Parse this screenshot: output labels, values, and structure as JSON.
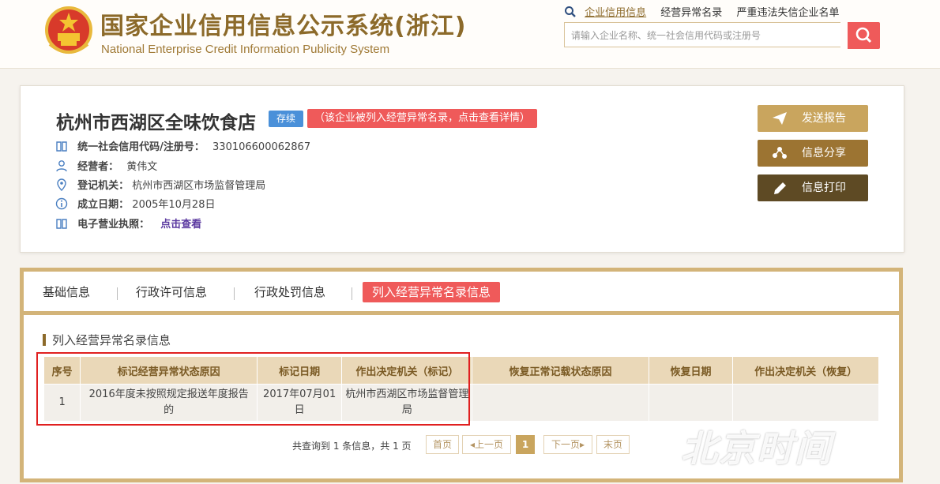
{
  "header": {
    "title_cn": "国家企业信用信息公示系统(浙江)",
    "title_en": "National Enterprise Credit Information Publicity System",
    "emblem_icon": "national-emblem-icon",
    "links": [
      "企业信用信息",
      "经营异常名录",
      "严重违法失信企业名单"
    ],
    "search_placeholder": "请输入企业名称、统一社会信用代码或注册号"
  },
  "company": {
    "name": "杭州市西湖区全味饮食店",
    "status": "存续",
    "alert": "（该企业被列入经营异常名录，点击查看详情）",
    "credit_code_label": "统一社会信用代码/注册号：",
    "credit_code": "330106600062867",
    "operator_label": "经营者：",
    "operator": "黄伟文",
    "authority_label": "登记机关：",
    "authority": "杭州市西湖区市场监督管理局",
    "date_label": "成立日期：",
    "date": "2005年10月28日",
    "license_label": "电子营业执照：",
    "license_link": "点击查看"
  },
  "actions": {
    "send": "发送报告",
    "share": "信息分享",
    "print": "信息打印",
    "colors": [
      "#c9a55e",
      "#9c7432",
      "#5e4a24"
    ]
  },
  "tabs": [
    "基础信息",
    "行政许可信息",
    "行政处罚信息",
    "列入经营异常名录信息"
  ],
  "section": {
    "title": "列入经营异常名录信息",
    "headers": [
      "序号",
      "标记经营异常状态原因",
      "标记日期",
      "作出决定机关（标记）",
      "恢复正常记载状态原因",
      "恢复日期",
      "作出决定机关（恢复）"
    ],
    "rows": [
      {
        "no": "1",
        "reason": "2016年度未按照规定报送年度报告的",
        "date": "2017年07月01日",
        "authority": "杭州市西湖区市场监督管理局",
        "restore_reason": "",
        "restore_date": "",
        "restore_authority": ""
      }
    ]
  },
  "pager": {
    "info": "共查询到 1 条信息，共 1 页",
    "first": "首页",
    "prev": "上一页",
    "current": "1",
    "next": "下一页",
    "last": "末页"
  },
  "watermark": "北京时间",
  "colors": {
    "accent_gold": "#8c6a2a",
    "alert_red": "#ef5a5a",
    "status_blue": "#4a90d9",
    "tab_border": "#d3b479"
  }
}
